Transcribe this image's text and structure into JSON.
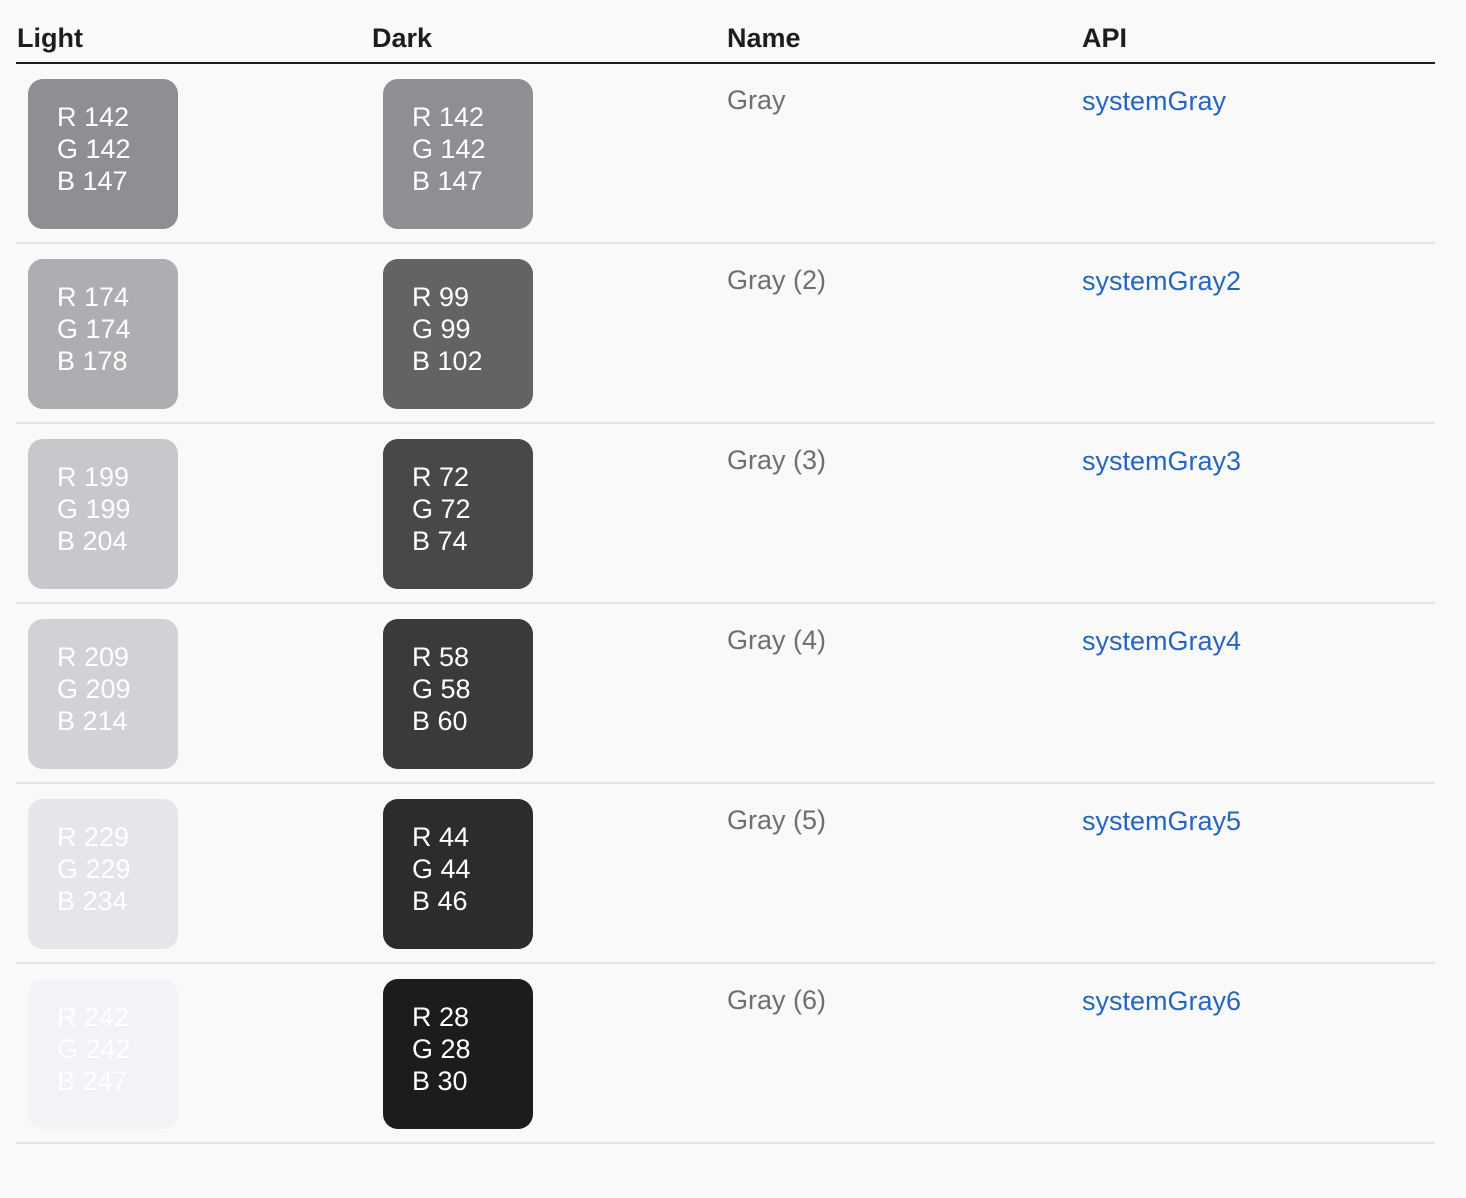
{
  "header": {
    "light": "Light",
    "dark": "Dark",
    "name": "Name",
    "api": "API"
  },
  "colors": {
    "text_primary": "#1d1d1f",
    "text_secondary": "#6e6e73",
    "link": "#2565c0",
    "background": "#f9f9f9"
  },
  "rows": [
    {
      "light": {
        "r": "R 142",
        "g": "G 142",
        "b": "B 147",
        "color": "#8e8e93"
      },
      "dark": {
        "r": "R 142",
        "g": "G 142",
        "b": "B 147",
        "color": "#8e8e93"
      },
      "name": "Gray",
      "api": "systemGray"
    },
    {
      "light": {
        "r": "R 174",
        "g": "G 174",
        "b": "B 178",
        "color": "#aeaeb2"
      },
      "dark": {
        "r": "R 99",
        "g": "G 99",
        "b": "B 102",
        "color": "#636366"
      },
      "name": "Gray (2)",
      "api": "systemGray2"
    },
    {
      "light": {
        "r": "R 199",
        "g": "G 199",
        "b": "B 204",
        "color": "#c7c7cc"
      },
      "dark": {
        "r": "R 72",
        "g": "G 72",
        "b": "B 74",
        "color": "#48484a"
      },
      "name": "Gray (3)",
      "api": "systemGray3"
    },
    {
      "light": {
        "r": "R 209",
        "g": "G 209",
        "b": "B 214",
        "color": "#d1d1d6"
      },
      "dark": {
        "r": "R 58",
        "g": "G 58",
        "b": "B 60",
        "color": "#3a3a3c"
      },
      "name": "Gray (4)",
      "api": "systemGray4"
    },
    {
      "light": {
        "r": "R 229",
        "g": "G 229",
        "b": "B 234",
        "color": "#e5e5ea"
      },
      "dark": {
        "r": "R 44",
        "g": "G 44",
        "b": "B 46",
        "color": "#2c2c2e"
      },
      "name": "Gray (5)",
      "api": "systemGray5"
    },
    {
      "light": {
        "r": "R 242",
        "g": "G 242",
        "b": "B 247",
        "color": "#f2f2f7"
      },
      "dark": {
        "r": "R 28",
        "g": "G 28",
        "b": "B 30",
        "color": "#1c1c1e"
      },
      "name": "Gray (6)",
      "api": "systemGray6"
    }
  ]
}
